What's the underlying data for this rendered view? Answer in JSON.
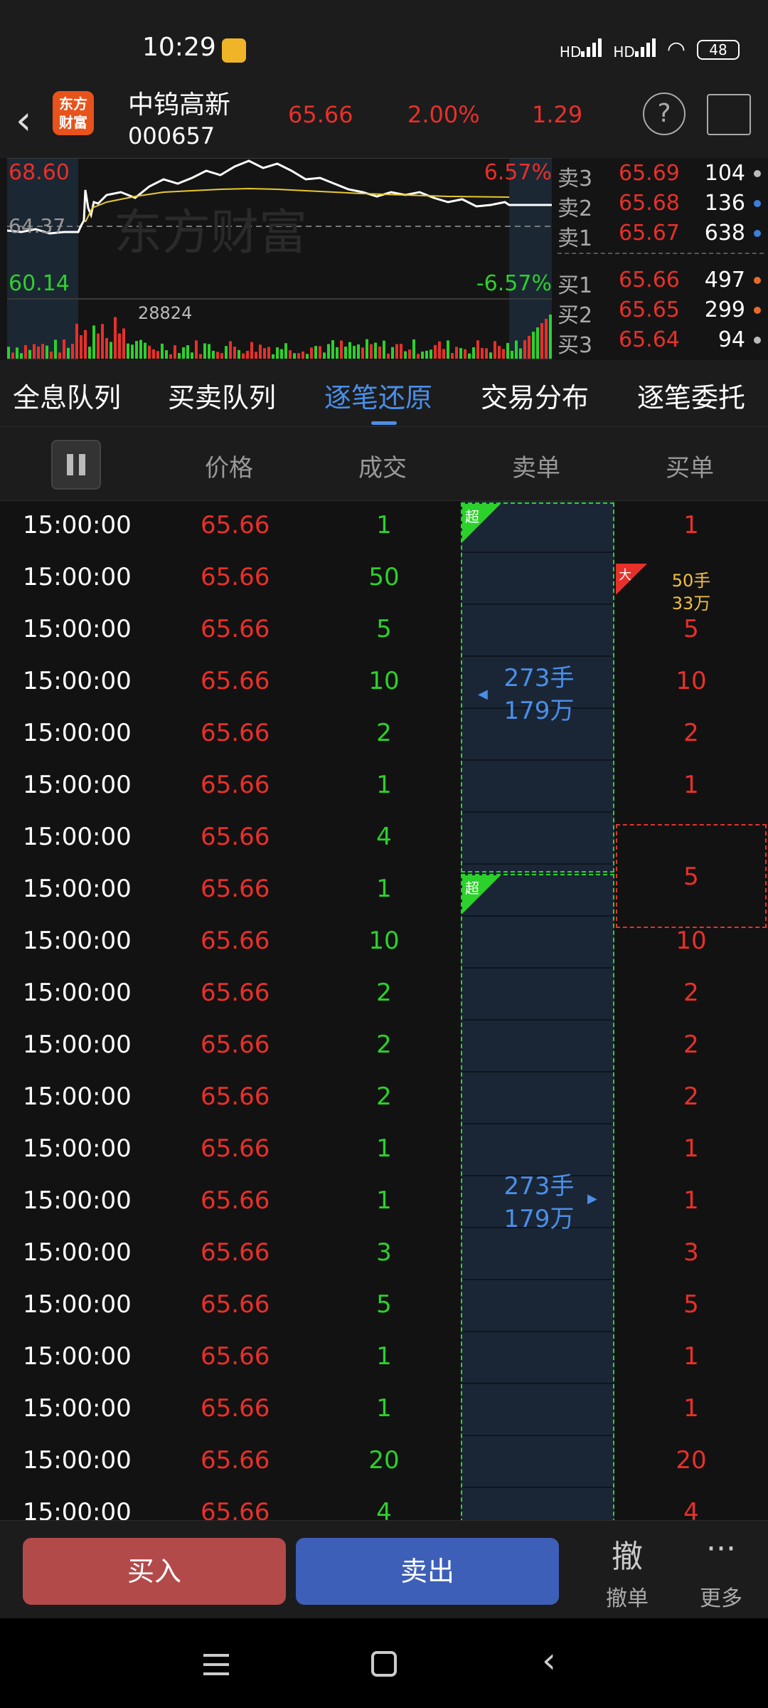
{
  "status": {
    "time": "10:29",
    "battery": "48",
    "net1": "HD",
    "net2": "HD"
  },
  "header": {
    "logo_text": "东方财富",
    "name": "中钨高新",
    "code": "000657",
    "price": "65.66",
    "pct": "2.00%",
    "change": "1.29"
  },
  "chart": {
    "high": "68.60",
    "mid": "64.37",
    "low": "60.14",
    "high_pct": "6.57%",
    "low_pct": "-6.57%",
    "volume": "28824",
    "watermark": "东方财富"
  },
  "orderbook": {
    "asks": [
      {
        "label": "卖3",
        "price": "65.69",
        "vol": "104"
      },
      {
        "label": "卖2",
        "price": "65.68",
        "vol": "136"
      },
      {
        "label": "卖1",
        "price": "65.67",
        "vol": "638"
      }
    ],
    "bids": [
      {
        "label": "买1",
        "price": "65.66",
        "vol": "497"
      },
      {
        "label": "买2",
        "price": "65.65",
        "vol": "299"
      },
      {
        "label": "买3",
        "price": "65.64",
        "vol": "94"
      }
    ],
    "dot_colors": [
      "#bbbbbb",
      "#3d7fd6",
      "#3d7fd6",
      "#e86a2a",
      "#e86a2a",
      "#bbbbbb"
    ]
  },
  "tabs": [
    "全息队列",
    "买卖队列",
    "逐笔还原",
    "交易分布",
    "逐笔委托"
  ],
  "columns": {
    "price": "价格",
    "volume": "成交",
    "sell": "卖单",
    "buy": "买单"
  },
  "rows": [
    {
      "time": "15:00:00",
      "price": "65.66",
      "vol": "1",
      "buy": "1"
    },
    {
      "time": "15:00:00",
      "price": "65.66",
      "vol": "50",
      "buy": ""
    },
    {
      "time": "15:00:00",
      "price": "65.66",
      "vol": "5",
      "buy": "5"
    },
    {
      "time": "15:00:00",
      "price": "65.66",
      "vol": "10",
      "buy": "10"
    },
    {
      "time": "15:00:00",
      "price": "65.66",
      "vol": "2",
      "buy": "2"
    },
    {
      "time": "15:00:00",
      "price": "65.66",
      "vol": "1",
      "buy": "1"
    },
    {
      "time": "15:00:00",
      "price": "65.66",
      "vol": "4",
      "buy": ""
    },
    {
      "time": "15:00:00",
      "price": "65.66",
      "vol": "1",
      "buy": ""
    },
    {
      "time": "15:00:00",
      "price": "65.66",
      "vol": "10",
      "buy": "10"
    },
    {
      "time": "15:00:00",
      "price": "65.66",
      "vol": "2",
      "buy": "2"
    },
    {
      "time": "15:00:00",
      "price": "65.66",
      "vol": "2",
      "buy": "2"
    },
    {
      "time": "15:00:00",
      "price": "65.66",
      "vol": "2",
      "buy": "2"
    },
    {
      "time": "15:00:00",
      "price": "65.66",
      "vol": "1",
      "buy": "1"
    },
    {
      "time": "15:00:00",
      "price": "65.66",
      "vol": "1",
      "buy": "1"
    },
    {
      "time": "15:00:00",
      "price": "65.66",
      "vol": "3",
      "buy": "3"
    },
    {
      "time": "15:00:00",
      "price": "65.66",
      "vol": "5",
      "buy": "5"
    },
    {
      "time": "15:00:00",
      "price": "65.66",
      "vol": "1",
      "buy": "1"
    },
    {
      "time": "15:00:00",
      "price": "65.66",
      "vol": "1",
      "buy": "1"
    },
    {
      "time": "15:00:00",
      "price": "65.66",
      "vol": "20",
      "buy": "20"
    },
    {
      "time": "15:00:00",
      "price": "65.66",
      "vol": "4",
      "buy": "4"
    }
  ],
  "sell_orders": [
    {
      "tag": "超",
      "lots": "273手",
      "amount": "179万"
    },
    {
      "tag": "超",
      "lots": "273手",
      "amount": "179万"
    }
  ],
  "buy_orders": {
    "big_tag": "大",
    "big_lots": "50手",
    "big_amount": "33万",
    "merged_value": "5"
  },
  "actions": {
    "buy": "买入",
    "sell": "卖出",
    "cancel_icon": "撤",
    "cancel": "撤单",
    "more_icon": "···",
    "more": "更多"
  }
}
